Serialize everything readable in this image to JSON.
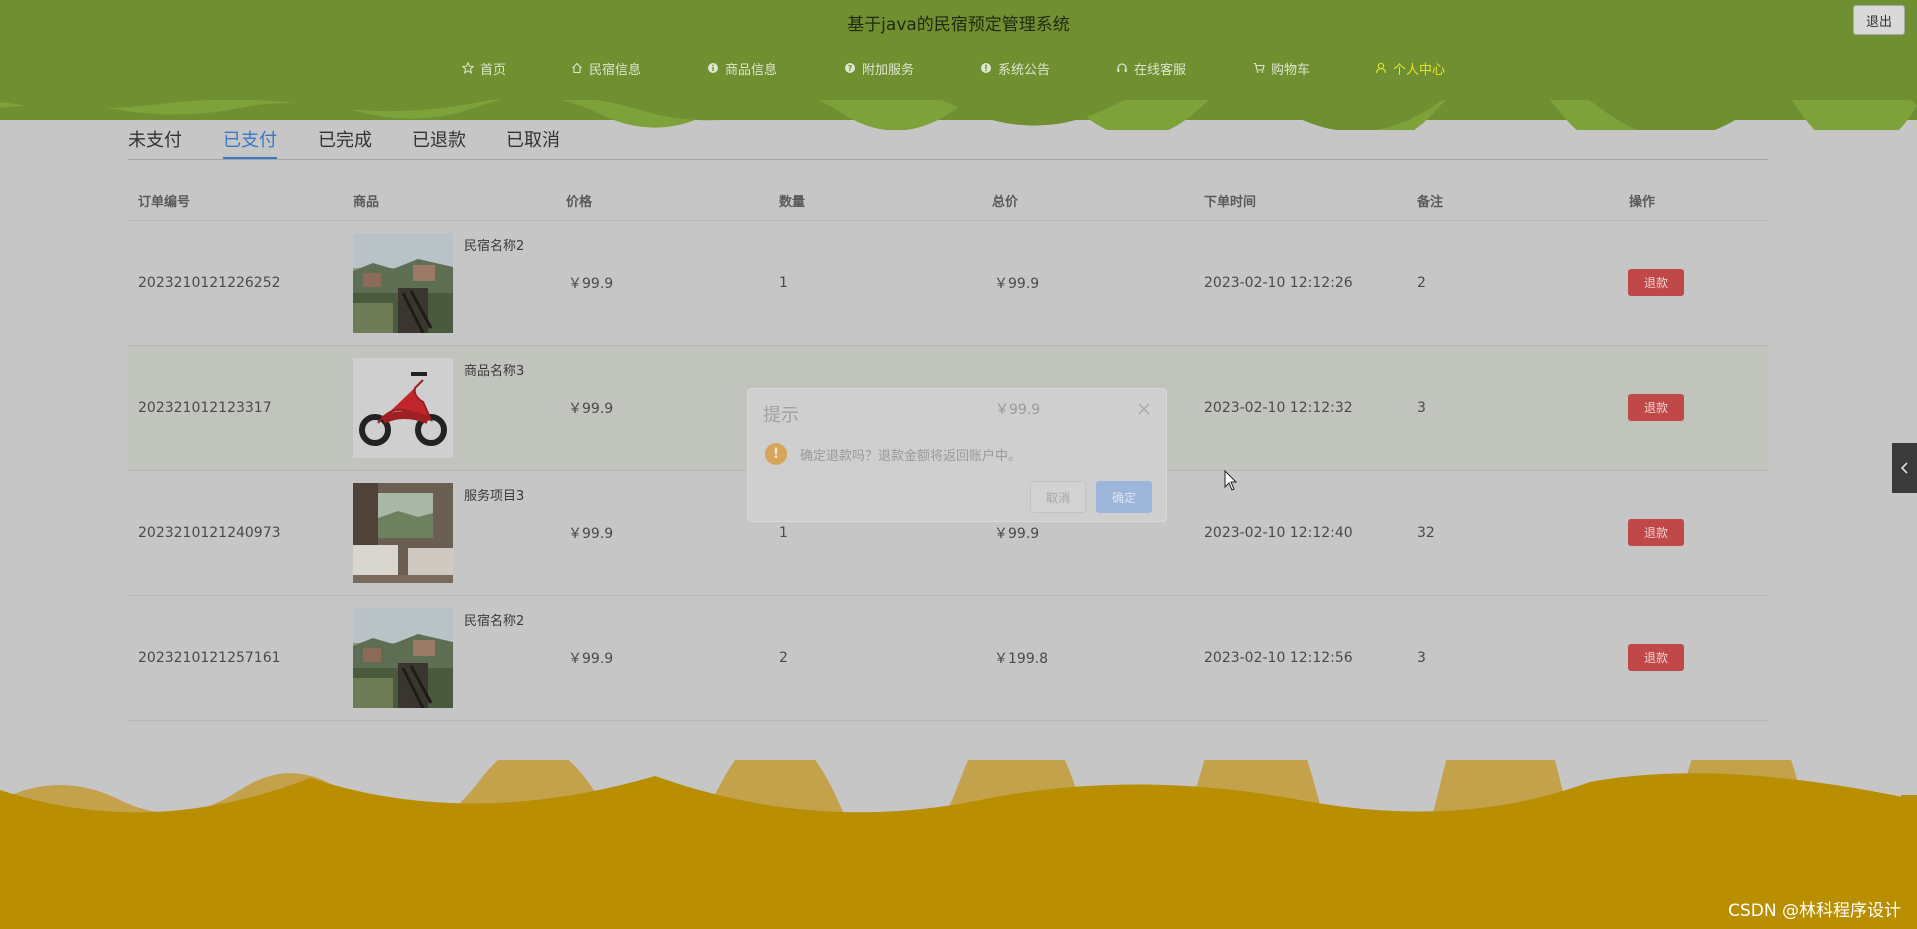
{
  "header": {
    "title": "基于java的民宿预定管理系统",
    "logout_label": "退出",
    "nav": [
      {
        "label": "首页",
        "icon": "star-icon"
      },
      {
        "label": "民宿信息",
        "icon": "home-icon"
      },
      {
        "label": "商品信息",
        "icon": "info-circle-icon"
      },
      {
        "label": "附加服务",
        "icon": "question-circle-icon"
      },
      {
        "label": "系统公告",
        "icon": "info-circle-icon"
      },
      {
        "label": "在线客服",
        "icon": "headset-icon"
      },
      {
        "label": "购物车",
        "icon": "cart-icon"
      },
      {
        "label": "个人中心",
        "icon": "user-icon",
        "active": true
      }
    ]
  },
  "tabs": [
    {
      "label": "未支付"
    },
    {
      "label": "已支付",
      "active": true
    },
    {
      "label": "已完成"
    },
    {
      "label": "已退款"
    },
    {
      "label": "已取消"
    }
  ],
  "table": {
    "columns": [
      "订单编号",
      "商品",
      "价格",
      "数量",
      "总价",
      "下单时间",
      "备注",
      "操作"
    ],
    "rows": [
      {
        "order_no": "2023210121226252",
        "product": "民宿名称2",
        "image": "balcony-village-photo",
        "price": "￥99.9",
        "qty": "1",
        "total": "￥99.9",
        "time": "2023-02-10 12:12:26",
        "note": "2",
        "action": "退款"
      },
      {
        "order_no": "202321012123317",
        "product": "商品名称3",
        "image": "red-scooter-photo",
        "price": "￥99.9",
        "qty": "",
        "total": "",
        "time": "2023-02-10 12:12:32",
        "note": "3",
        "action": "退款"
      },
      {
        "order_no": "2023210121240973",
        "product": "服务项目3",
        "image": "bedroom-view-photo",
        "price": "￥99.9",
        "qty": "1",
        "total": "￥99.9",
        "time": "2023-02-10 12:12:40",
        "note": "32",
        "action": "退款"
      },
      {
        "order_no": "2023210121257161",
        "product": "民宿名称2",
        "image": "balcony-village-photo",
        "price": "￥99.9",
        "qty": "2",
        "total": "￥199.8",
        "time": "2023-02-10 12:12:56",
        "note": "3",
        "action": "退款"
      }
    ]
  },
  "dialog": {
    "title": "提示",
    "message": "确定退款吗？退款金额将返回账户中。",
    "peek_total": "￥99.9",
    "cancel_label": "取消",
    "confirm_label": "确定"
  },
  "watermark": "CSDN @林科程序设计",
  "colors": {
    "header_bg": "#6f8f31",
    "accent_blue": "#3a78c4",
    "refund_red": "#c04848",
    "footer_gold": "#b98e00",
    "active_nav": "#e6e62a"
  }
}
